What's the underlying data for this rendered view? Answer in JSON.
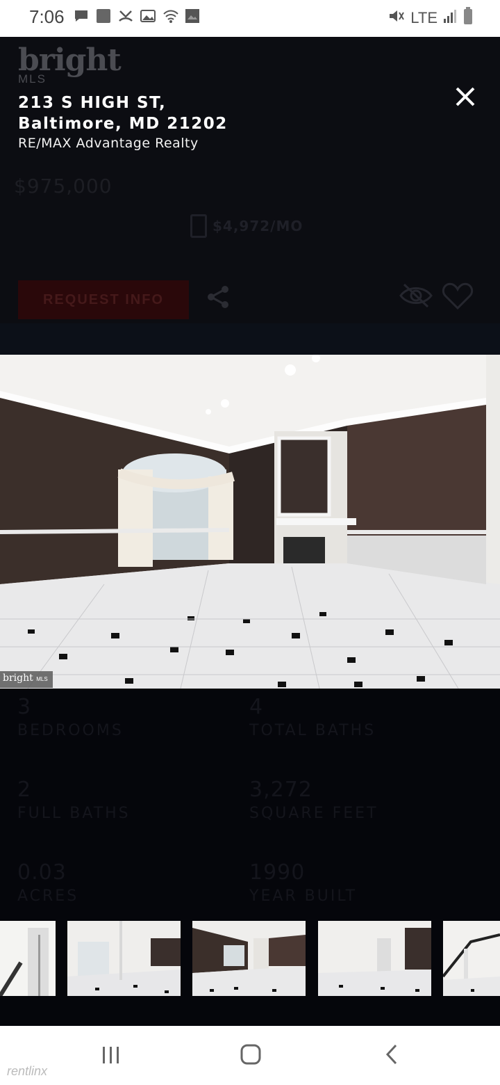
{
  "status_bar": {
    "time": "7:06",
    "network": "LTE"
  },
  "header": {
    "logo_text": "bright",
    "logo_sub": "MLS",
    "address_line1": "213 S HIGH ST,",
    "address_line2": "Baltimore, MD 21202",
    "brokerage": "RE/MAX Advantage Realty",
    "price": "$975,000",
    "monthly": "$4,972/MO",
    "request_button": "REQUEST INFO"
  },
  "photo": {
    "watermark": "bright",
    "watermark_sub": "MLS"
  },
  "stats": [
    {
      "value": "3",
      "label": "BEDROOMS"
    },
    {
      "value": "4",
      "label": "TOTAL BATHS"
    },
    {
      "value": "2",
      "label": "FULL BATHS"
    },
    {
      "value": "3,272",
      "label": "SQUARE FEET"
    },
    {
      "value": "0.03",
      "label": "ACRES"
    },
    {
      "value": "1990",
      "label": "YEAR BUILT"
    }
  ],
  "footer": {
    "watermark": "rentlinx"
  },
  "colors": {
    "overlay": "#05060b",
    "accent_red": "#c0392b",
    "white": "#ffffff"
  },
  "icons": [
    "message-icon",
    "app-icon",
    "missed-call-icon",
    "image-icon",
    "wifi-icon",
    "photo-icon",
    "mute-icon",
    "signal-icon",
    "battery-icon",
    "close-icon",
    "calculator-icon",
    "share-icon",
    "hide-icon",
    "heart-icon",
    "recents-icon",
    "home-icon",
    "back-icon"
  ]
}
